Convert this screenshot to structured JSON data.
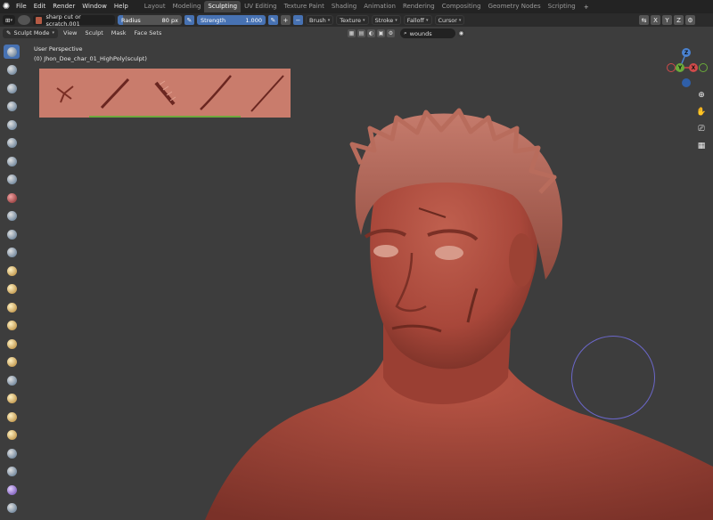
{
  "menu": {
    "items": [
      "File",
      "Edit",
      "Render",
      "Window",
      "Help"
    ]
  },
  "workspaces": {
    "tabs": [
      "Layout",
      "Modeling",
      "Sculpting",
      "UV Editing",
      "Texture Paint",
      "Shading",
      "Animation",
      "Rendering",
      "Compositing",
      "Geometry Nodes",
      "Scripting"
    ],
    "active": "Sculpting"
  },
  "tool_settings": {
    "brush_name": "sharp cut or scratch.001",
    "radius_label": "Radius",
    "radius_value": "80 px",
    "strength_label": "Strength",
    "strength_value": "1.000",
    "strength_fraction": 1.0,
    "dropdowns": [
      "Brush",
      "Texture",
      "Stroke",
      "Falloff",
      "Cursor"
    ],
    "axis_locks": [
      "X",
      "Y",
      "Z"
    ]
  },
  "header": {
    "mode": "Sculpt Mode",
    "menus": [
      "View",
      "Sculpt",
      "Mask",
      "Face Sets"
    ],
    "search_value": "wounds"
  },
  "viewport": {
    "perspective": "User Perspective",
    "object": "(0) Jhon_Doe_char_01_HighPoly(sculpt)",
    "brush_color": "#6b67c9",
    "skin_color": "#a8473a"
  },
  "gizmo": {
    "axes": [
      "X",
      "Y",
      "Z"
    ]
  }
}
